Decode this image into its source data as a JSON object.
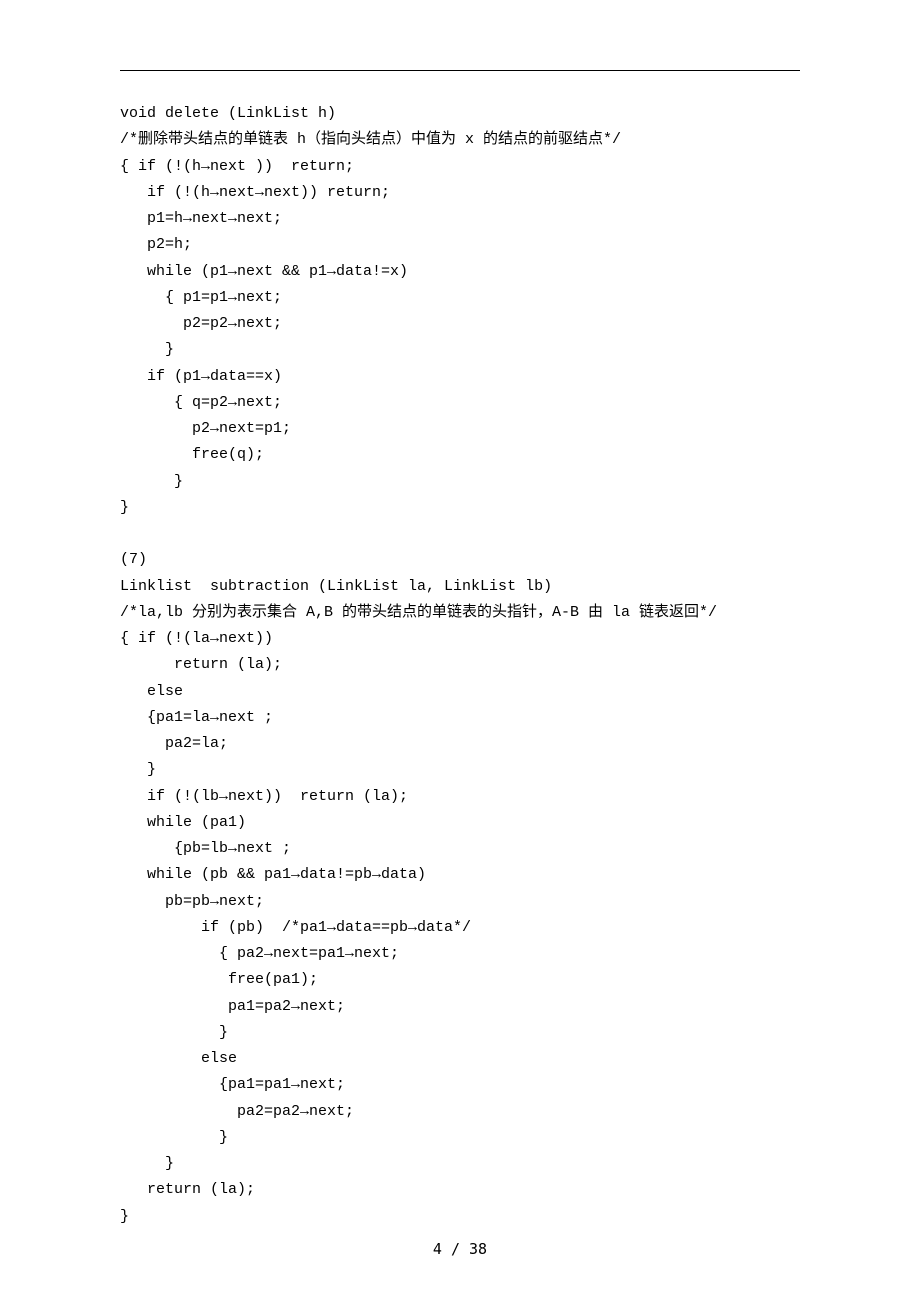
{
  "page": {
    "number_label": "4 / 38"
  },
  "code": {
    "block1": "void delete (LinkList h)\n/*删除带头结点的单链表 h（指向头结点）中值为 x 的结点的前驱结点*/\n{ if (!(h→next ))  return;\n   if (!(h→next→next)) return;\n   p1=h→next→next;\n   p2=h;\n   while (p1→next && p1→data!=x)\n     { p1=p1→next;\n       p2=p2→next;\n     }\n   if (p1→data==x)\n      { q=p2→next;\n        p2→next=p1;\n        free(q);\n      }\n}\n\n(7)\nLinklist  subtraction (LinkList la, LinkList lb)\n/*la,lb 分别为表示集合 A,B 的带头结点的单链表的头指针，A-B 由 la 链表返回*/\n{ if (!(la→next))\n      return (la);\n   else\n   {pa1=la→next ;\n     pa2=la;\n   }\n   if (!(lb→next))  return (la);\n   while (pa1)\n      {pb=lb→next ;\n   while (pb && pa1→data!=pb→data)\n     pb=pb→next;\n         if (pb)  /*pa1→data==pb→data*/\n           { pa2→next=pa1→next;\n            free(pa1);\n            pa1=pa2→next;\n           }\n         else\n           {pa1=pa1→next;\n             pa2=pa2→next;\n           }\n     }\n   return (la);\n}"
  }
}
